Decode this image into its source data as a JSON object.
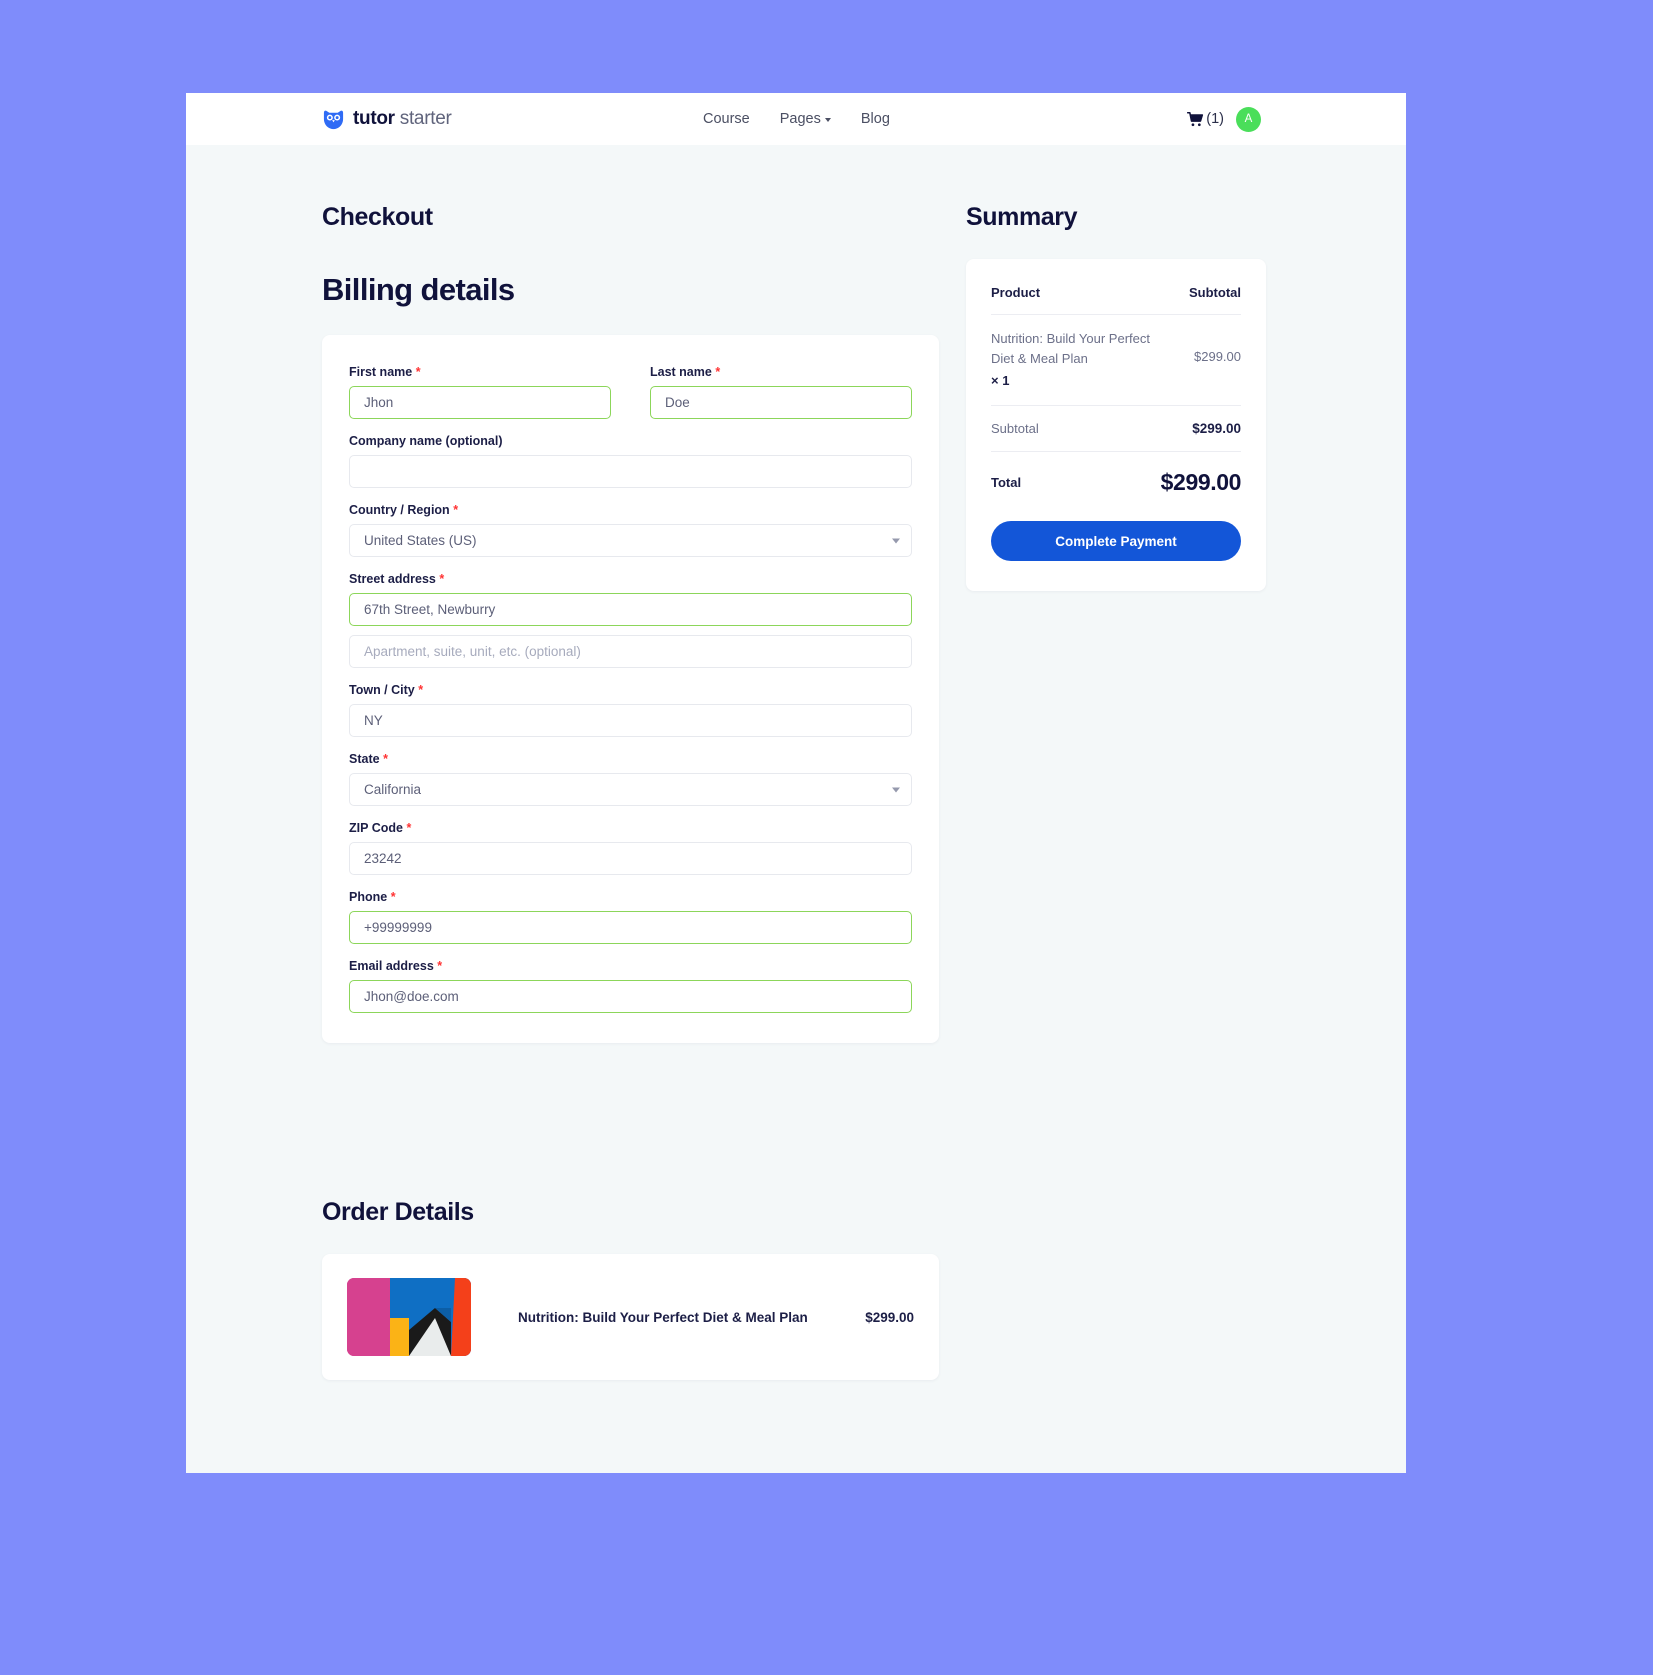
{
  "header": {
    "brand_bold": "tutor",
    "brand_light": " starter",
    "nav": [
      {
        "label": "Course",
        "has_caret": false
      },
      {
        "label": "Pages",
        "has_caret": true
      },
      {
        "label": "Blog",
        "has_caret": false
      }
    ],
    "cart_count": "(1)",
    "avatar_initial": "A"
  },
  "main": {
    "checkout_title": "Checkout",
    "billing_title": "Billing details",
    "order_title": "Order Details"
  },
  "form": {
    "first_name": {
      "label": "First name",
      "required": true,
      "value": "Jhon",
      "state": "valid"
    },
    "last_name": {
      "label": "Last name",
      "required": true,
      "value": "Doe",
      "state": "valid"
    },
    "company": {
      "label": "Company name (optional)",
      "required": false,
      "value": "",
      "state": "empty"
    },
    "country": {
      "label": "Country / Region",
      "required": true,
      "value": "United States (US)",
      "state": "select"
    },
    "street": {
      "label": "Street address",
      "required": true,
      "value": "67th Street, Newburry",
      "state": "valid"
    },
    "apartment": {
      "label": "",
      "required": false,
      "placeholder": "Apartment, suite, unit, etc. (optional)",
      "value": "",
      "state": "placeholder"
    },
    "city": {
      "label": "Town / City",
      "required": true,
      "value": "NY",
      "state": "filled"
    },
    "state": {
      "label": "State",
      "required": true,
      "value": "California",
      "state": "select"
    },
    "zip": {
      "label": "ZIP Code",
      "required": true,
      "value": "23242",
      "state": "filled"
    },
    "phone": {
      "label": "Phone",
      "required": true,
      "value": "+99999999",
      "state": "valid"
    },
    "email": {
      "label": "Email address",
      "required": true,
      "value": "Jhon@doe.com",
      "state": "valid"
    }
  },
  "summary": {
    "title": "Summary",
    "col_product": "Product",
    "col_subtotal": "Subtotal",
    "product_name": "Nutrition: Build Your Perfect Diet & Meal Plan",
    "product_qty": "× 1",
    "product_price": "$299.00",
    "subtotal_label": "Subtotal",
    "subtotal_value": "$299.00",
    "total_label": "Total",
    "total_value": "$299.00",
    "pay_button": "Complete Payment"
  },
  "order": {
    "product_name": "Nutrition: Build Your Perfect Diet & Meal Plan",
    "price": "$299.00"
  },
  "colors": {
    "page_bg": "#7f8cfb",
    "content_bg": "#f4f8f9",
    "accent_blue": "#1356d8",
    "brand_navy": "#10123b",
    "valid_green": "#8cd65a",
    "required_red": "#ff3333",
    "avatar_green": "#4ade5a"
  }
}
